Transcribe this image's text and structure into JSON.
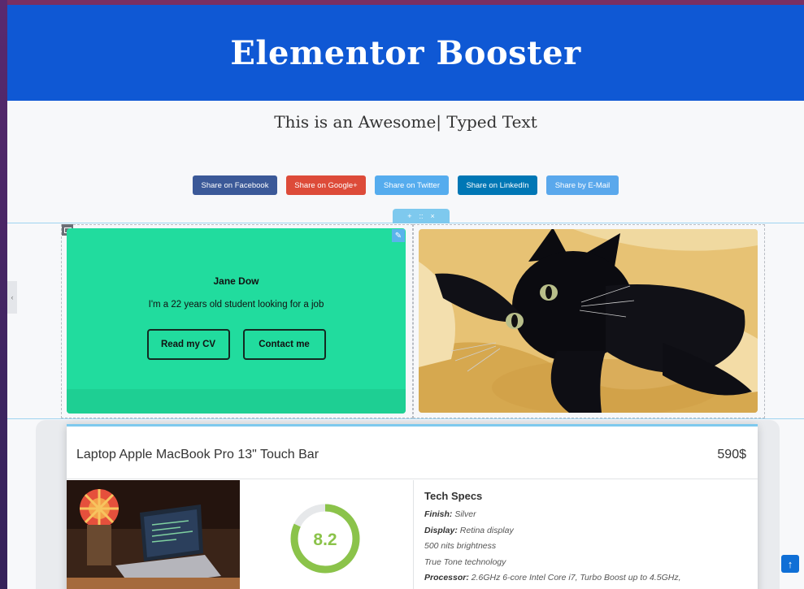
{
  "banner": {
    "title": "Elementor Booster"
  },
  "typed_text": "This is an Awesome| Typed Text",
  "share_buttons": [
    {
      "label": "Share on Facebook",
      "color": "#3b5998"
    },
    {
      "label": "Share on Google+",
      "color": "#dd4b39"
    },
    {
      "label": "Share on Twitter",
      "color": "#55acee"
    },
    {
      "label": "Share on LinkedIn",
      "color": "#0077b5"
    },
    {
      "label": "Share by E-Mail",
      "color": "#5aa8ec"
    }
  ],
  "section_handle": {
    "add": "+",
    "move": "::",
    "close": "×"
  },
  "profile_card": {
    "name": "Jane Dow",
    "tagline": "I'm a 22 years old student looking for a job",
    "buttons": {
      "cv": "Read my CV",
      "contact": "Contact me"
    },
    "background": "#21dc9e"
  },
  "product": {
    "title": "Laptop Apple MacBook Pro 13\" Touch Bar",
    "price": "590$",
    "score": "8.2",
    "score_fraction": 0.82,
    "specs": {
      "heading": "Tech Specs",
      "finish_label": "Finish:",
      "finish_value": " Silver",
      "display_label": "Display:",
      "display_value": " Retina display",
      "line3": "500 nits brightness",
      "line4": "True Tone technology",
      "processor_label": "Processor:",
      "processor_value": " 2.6GHz 6-core Intel Core i7, Turbo Boost up to 4.5GHz,"
    }
  },
  "scroll_top": {
    "icon": "arrow-up-icon",
    "glyph": "↑"
  },
  "edit_icon": "✎",
  "left_tab_glyph": "‹"
}
